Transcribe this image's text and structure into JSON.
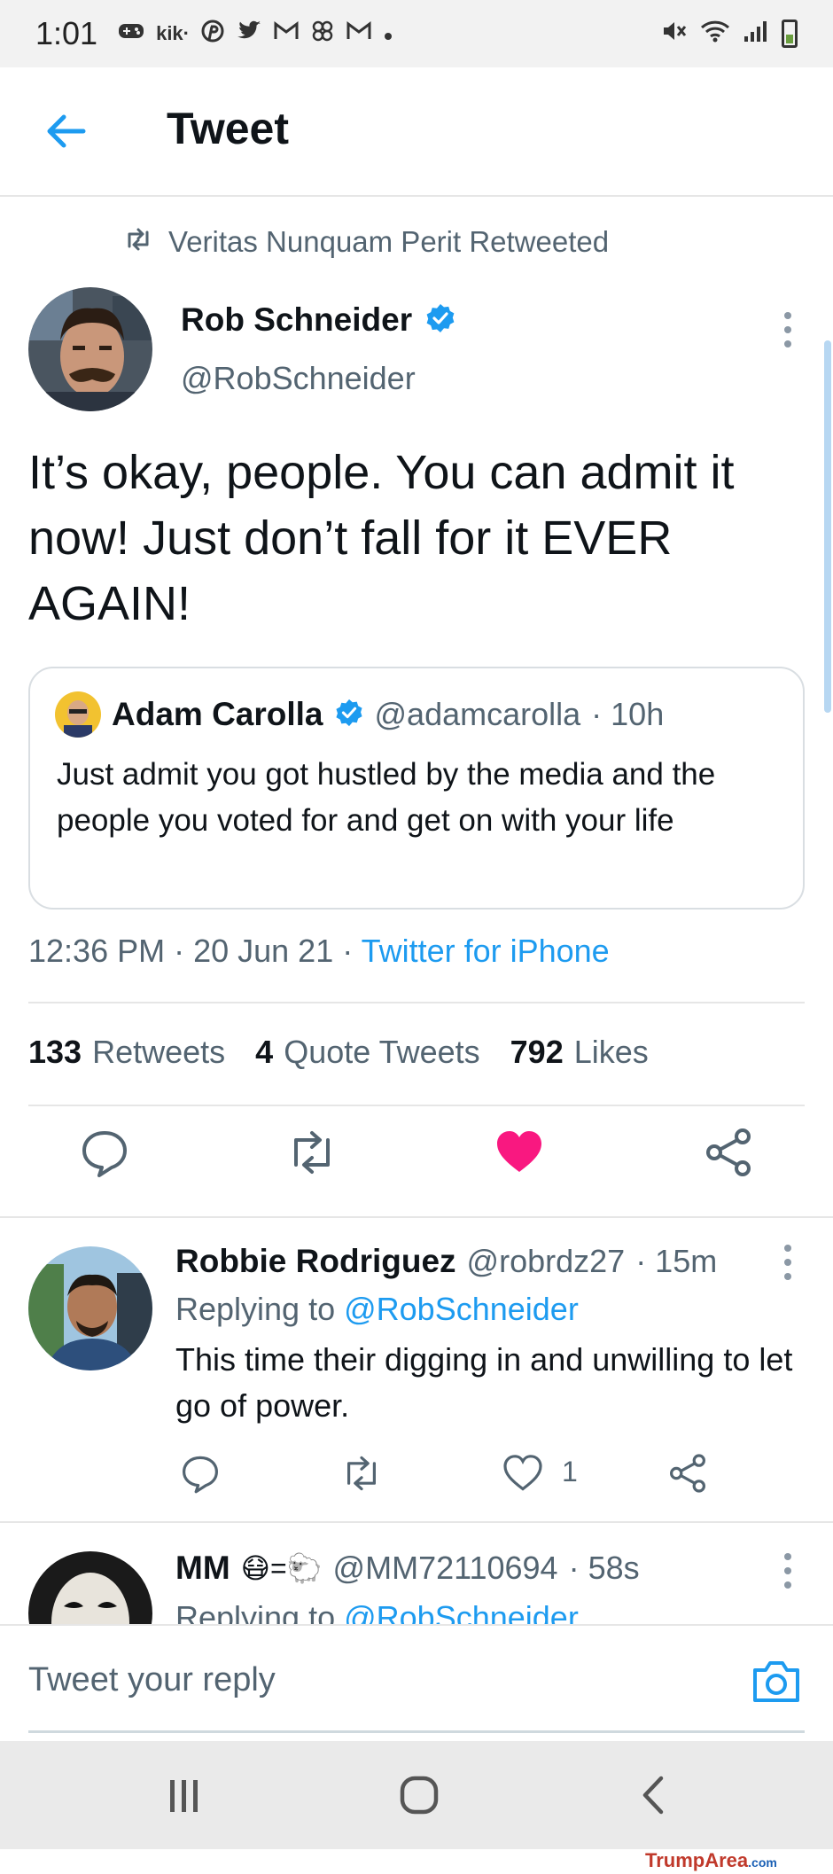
{
  "status_bar": {
    "time": "1:01",
    "notif_icons": [
      "game-icon",
      "kik-icon",
      "pinterest-icon",
      "twitter-icon",
      "gmail-icon",
      "pinwheel-icon",
      "gmail-icon",
      "dot-icon"
    ],
    "kik_label": "kik·",
    "right_icons": [
      "mute-icon",
      "wifi-icon",
      "signal-icon",
      "battery-icon"
    ]
  },
  "header": {
    "title": "Tweet",
    "back_icon": "arrow-left-icon"
  },
  "retweet_line": {
    "text": "Veritas Nunquam Perit Retweeted"
  },
  "tweet": {
    "author_name": "Rob Schneider",
    "author_handle": "@RobSchneider",
    "text": "It’s okay, people. You can admit it now! Just don’t fall for it EVER AGAIN!",
    "quote": {
      "author_name": "Adam Carolla",
      "author_handle": "@adamcarolla",
      "time": "· 10h",
      "text": "Just admit you got hustled by the media and the people you voted for and get on with your life"
    },
    "meta_time": "12:36 PM · 20 Jun 21 · ",
    "meta_source": "Twitter for iPhone",
    "stats": {
      "retweets_count": "133",
      "retweets_label": "Retweets",
      "quotes_count": "4",
      "quotes_label": "Quote Tweets",
      "likes_count": "792",
      "likes_label": "Likes"
    }
  },
  "replies": [
    {
      "author_name": "Robbie Rodriguez",
      "author_handle": "@robrdz27",
      "time": "· 15m",
      "replying_prefix": "Replying to ",
      "replying_to": "@RobSchneider",
      "text": "This time their digging in and unwilling to let go of power.",
      "like_count": "1"
    },
    {
      "author_name": "MM",
      "name_emoji": "😷=🐑",
      "author_handle": "@MM72110694",
      "time": "· 58s",
      "replying_prefix": "Replying to ",
      "replying_to": "@RobSchneider"
    }
  ],
  "composer": {
    "placeholder": "Tweet your reply"
  },
  "watermark": {
    "brand": "TrumpArea",
    "suffix": ".com"
  },
  "colors": {
    "accent": "#1d9bf0",
    "like": "#f91880",
    "text": "#0f1419",
    "muted": "#536471"
  }
}
